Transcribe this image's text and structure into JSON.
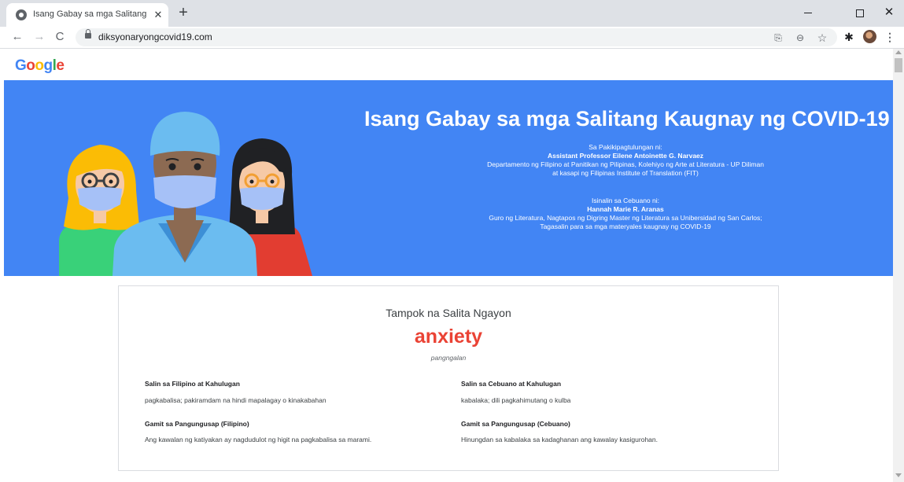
{
  "browser": {
    "tab_title": "Isang Gabay sa mga Salitang Kaugnay ng COVID-19",
    "tab_close_glyph": "✕",
    "new_tab_glyph": "+",
    "close_glyph": "✕",
    "back_glyph": "←",
    "forward_glyph": "→",
    "reload_glyph": "C",
    "url": "diksyonaryongcovid19.com",
    "translate_glyph": "⎘",
    "zoom_glyph": "⊖",
    "star_glyph": "☆",
    "extensions_glyph": "✱",
    "menu_glyph": "⋮"
  },
  "logo": {
    "letters": [
      "G",
      "o",
      "o",
      "g",
      "l",
      "e"
    ],
    "colors": [
      "#4285f4",
      "#ea4335",
      "#fbbc05",
      "#4285f4",
      "#34a853",
      "#ea4335"
    ]
  },
  "hero": {
    "title": "Isang Gabay sa mga Salitang Kaugnay ng COVID-19",
    "collab_intro": "Sa Pakikipagtulungan ni:",
    "collab_name": "Assistant Professor Eilene Antoinette G. Narvaez",
    "collab_line1": "Departamento ng Filipino at Panitikan ng Pilipinas, Kolehiyo ng Arte at Literatura - UP Diliman",
    "collab_line2": "at kasapi ng Filipinas Institute of Translation (FIT)",
    "trans_intro": "Isinalin sa Cebuano ni:",
    "trans_name": "Hannah Marie R. Aranas",
    "trans_line1": "Guro ng Literatura, Nagtapos ng Digring Master ng Literatura sa Unibersidad ng San Carlos;",
    "trans_line2": "Tagasalin para sa mga materyales kaugnay ng COVID-19"
  },
  "word_card": {
    "heading": "Tampok na Salita Ngayon",
    "word": "anxiety",
    "part_of_speech": "pangngalan",
    "filipino_label": "Salin sa Filipino at Kahulugan",
    "filipino_value": "pagkabalisa; pakiramdam na hindi mapalagay o kinakabahan",
    "cebuano_label": "Salin sa Cebuano at Kahulugan",
    "cebuano_value": "kabalaka; dili pagkahimutang o kulba",
    "filipino_sentence_label": "Gamit sa Pangungusap (Filipino)",
    "filipino_sentence": "Ang kawalan ng katiyakan ay nagdudulot ng higit na pagkabalisa sa marami.",
    "cebuano_sentence_label": "Gamit sa Pangungusap (Cebuano)",
    "cebuano_sentence": "Hinungdan sa kabalaka sa kadaghanan ang kawalay kasigurohan."
  },
  "colors": {
    "hero_bg": "#4285f4",
    "word_accent": "#ea4335"
  }
}
